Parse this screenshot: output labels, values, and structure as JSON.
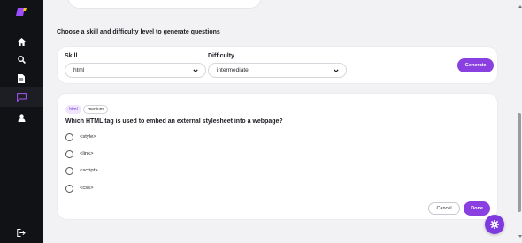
{
  "colors": {
    "accent": "#8a3fe0",
    "sidebar_bg": "#111216",
    "nav_active": "#a855f7"
  },
  "sidebar": {
    "logo": "app-logo",
    "items": [
      {
        "icon": "home-icon"
      },
      {
        "icon": "search-icon"
      },
      {
        "icon": "document-icon"
      },
      {
        "icon": "chat-icon",
        "active": true
      },
      {
        "icon": "user-icon"
      }
    ],
    "logout_icon": "logout-icon"
  },
  "generator": {
    "title": "Choose a skill and difficulty level to generate questions",
    "skill_label": "Skill",
    "skill_value": "html",
    "difficulty_label": "Difficulty",
    "difficulty_value": "intermediate",
    "generate_label": "Generate"
  },
  "question": {
    "skill_tag": "html",
    "difficulty_tag": "medium",
    "text": "Which HTML tag is used to embed an external stylesheet into a webpage?",
    "options": [
      "<style>",
      "<link>",
      "<script>",
      "<css>"
    ],
    "cancel_label": "Cancel",
    "done_label": "Done"
  },
  "fab_icon": "gear-icon"
}
